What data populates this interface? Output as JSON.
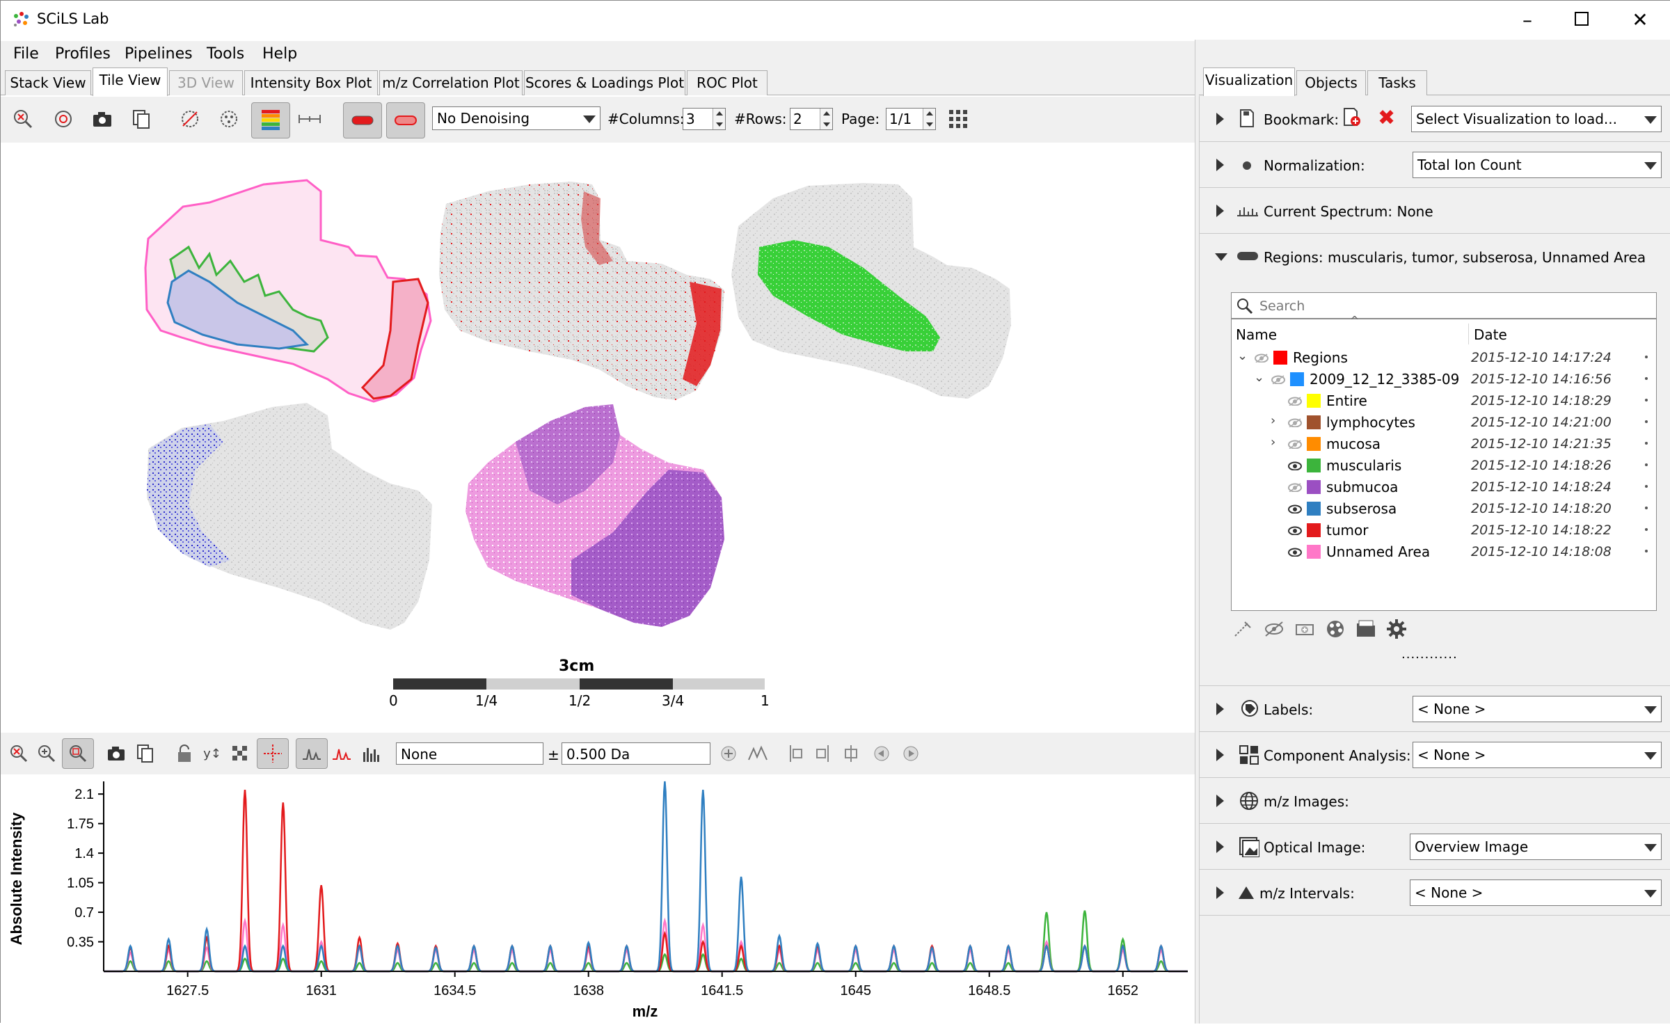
{
  "app": {
    "title": "SCiLS Lab"
  },
  "menu": [
    "File",
    "Profiles",
    "Pipelines",
    "Tools",
    "Help"
  ],
  "view_tabs": [
    "Stack View",
    "Tile View",
    "3D View",
    "Intensity Box Plot",
    "m/z Correlation Plot",
    "Scores & Loadings Plot",
    "ROC Plot"
  ],
  "toolbar": {
    "denoising": "No Denoising",
    "columns_label": "#Columns:",
    "columns_value": "3",
    "rows_label": "#Rows:",
    "rows_value": "2",
    "page_label": "Page:",
    "page_value": "1/1"
  },
  "scalebar": {
    "title": "3cm",
    "ticks": [
      "0",
      "1/4",
      "1/2",
      "3/4",
      "1"
    ]
  },
  "spectrum_toolbar": {
    "peak_value": "None",
    "plusminus": "±",
    "tolerance": "0.500 Da"
  },
  "right_tabs": [
    "Visualization",
    "Objects",
    "Tasks"
  ],
  "right_panel": {
    "bookmark_label": "Bookmark:",
    "bookmark_value": "Select Visualization to load...",
    "normalization_label": "Normalization:",
    "normalization_value": "Total Ion Count",
    "current_spectrum": "Current Spectrum: None",
    "regions_header": "Regions: muscularis, tumor, subserosa, Unnamed Area",
    "search_placeholder": "Search",
    "col_name": "Name",
    "col_date": "Date",
    "dots": "............",
    "labels_label": "Labels:",
    "labels_value": "< None >",
    "component_label": "Component Analysis:",
    "component_value": "< None >",
    "mz_images_label": "m/z Images:",
    "optical_label": "Optical Image:",
    "optical_value": "Overview Image",
    "mz_intervals_label": "m/z Intervals:",
    "mz_intervals_value": "< None >"
  },
  "regions": [
    {
      "name": "Regions",
      "date": "2015-12-10 14:17:24",
      "color": "#ff0000",
      "level": 0,
      "expander": "open",
      "visible": false
    },
    {
      "name": "2009_12_12_3385-09",
      "date": "2015-12-10 14:16:56",
      "color": "#1e90ff",
      "level": 1,
      "expander": "open",
      "visible": false
    },
    {
      "name": "Entire",
      "date": "2015-12-10 14:18:29",
      "color": "#ffff00",
      "level": 2,
      "expander": "",
      "visible": false
    },
    {
      "name": "lymphocytes",
      "date": "2015-12-10 14:21:00",
      "color": "#a0522d",
      "level": 2,
      "expander": "closed",
      "visible": false
    },
    {
      "name": "mucosa",
      "date": "2015-12-10 14:21:35",
      "color": "#ff8c00",
      "level": 2,
      "expander": "closed",
      "visible": false
    },
    {
      "name": "muscularis",
      "date": "2015-12-10 14:18:26",
      "color": "#3cb43c",
      "level": 2,
      "expander": "",
      "visible": true
    },
    {
      "name": "submucoa",
      "date": "2015-12-10 14:18:24",
      "color": "#9b4fc2",
      "level": 2,
      "expander": "",
      "visible": false
    },
    {
      "name": "subserosa",
      "date": "2015-12-10 14:18:20",
      "color": "#2f7fc1",
      "level": 2,
      "expander": "",
      "visible": true
    },
    {
      "name": "tumor",
      "date": "2015-12-10 14:18:22",
      "color": "#e31a1c",
      "level": 2,
      "expander": "",
      "visible": true
    },
    {
      "name": "Unnamed Area",
      "date": "2015-12-10 14:18:08",
      "color": "#ff77c8",
      "level": 2,
      "expander": "",
      "visible": true
    }
  ],
  "chart_data": {
    "type": "line",
    "xlabel": "m/z",
    "ylabel": "Absolute Intensity",
    "xlim": [
      1625.3,
      1653.7
    ],
    "ylim": [
      0,
      2.25
    ],
    "xticks": [
      "1627.5",
      "1631",
      "1634.5",
      "1638",
      "1641.5",
      "1645",
      "1648.5",
      "1652"
    ],
    "yticks": [
      "0.35",
      "0.7",
      "1.05",
      "1.4",
      "1.75",
      "2.1"
    ],
    "peak_mz": [
      1626.0,
      1627.0,
      1628.0,
      1629.0,
      1630.0,
      1631.0,
      1632.0,
      1633.0,
      1634.0,
      1635.0,
      1636.0,
      1637.0,
      1638.0,
      1639.0,
      1640.0,
      1641.0,
      1642.0,
      1643.0,
      1644.0,
      1645.0,
      1646.0,
      1647.0,
      1648.0,
      1649.0,
      1650.0,
      1651.0,
      1652.0,
      1653.0
    ],
    "series": [
      {
        "color": "#e31a1c",
        "values": [
          0.28,
          0.3,
          0.4,
          2.15,
          2.0,
          1.02,
          0.4,
          0.33,
          0.3,
          0.3,
          0.3,
          0.3,
          0.3,
          0.3,
          0.45,
          0.35,
          0.3,
          0.3,
          0.3,
          0.3,
          0.3,
          0.3,
          0.3,
          0.3,
          0.3,
          0.3,
          0.3,
          0.3
        ]
      },
      {
        "color": "#2f7fc1",
        "values": [
          0.3,
          0.38,
          0.5,
          0.3,
          0.3,
          0.3,
          0.3,
          0.3,
          0.28,
          0.3,
          0.3,
          0.3,
          0.34,
          0.3,
          2.25,
          2.15,
          1.12,
          0.42,
          0.33,
          0.3,
          0.3,
          0.28,
          0.3,
          0.3,
          0.3,
          0.3,
          0.3,
          0.3
        ]
      },
      {
        "color": "#3cb43c",
        "values": [
          0.12,
          0.12,
          0.12,
          0.15,
          0.15,
          0.12,
          0.1,
          0.1,
          0.1,
          0.1,
          0.1,
          0.1,
          0.1,
          0.1,
          0.2,
          0.2,
          0.15,
          0.1,
          0.1,
          0.1,
          0.1,
          0.1,
          0.1,
          0.1,
          0.7,
          0.72,
          0.38,
          0.12
        ]
      },
      {
        "color": "#ff77c8",
        "values": [
          0.22,
          0.25,
          0.28,
          0.6,
          0.55,
          0.35,
          0.28,
          0.25,
          0.25,
          0.25,
          0.25,
          0.25,
          0.25,
          0.25,
          0.6,
          0.55,
          0.35,
          0.25,
          0.25,
          0.25,
          0.25,
          0.25,
          0.25,
          0.25,
          0.35,
          0.3,
          0.25,
          0.25
        ]
      }
    ]
  }
}
